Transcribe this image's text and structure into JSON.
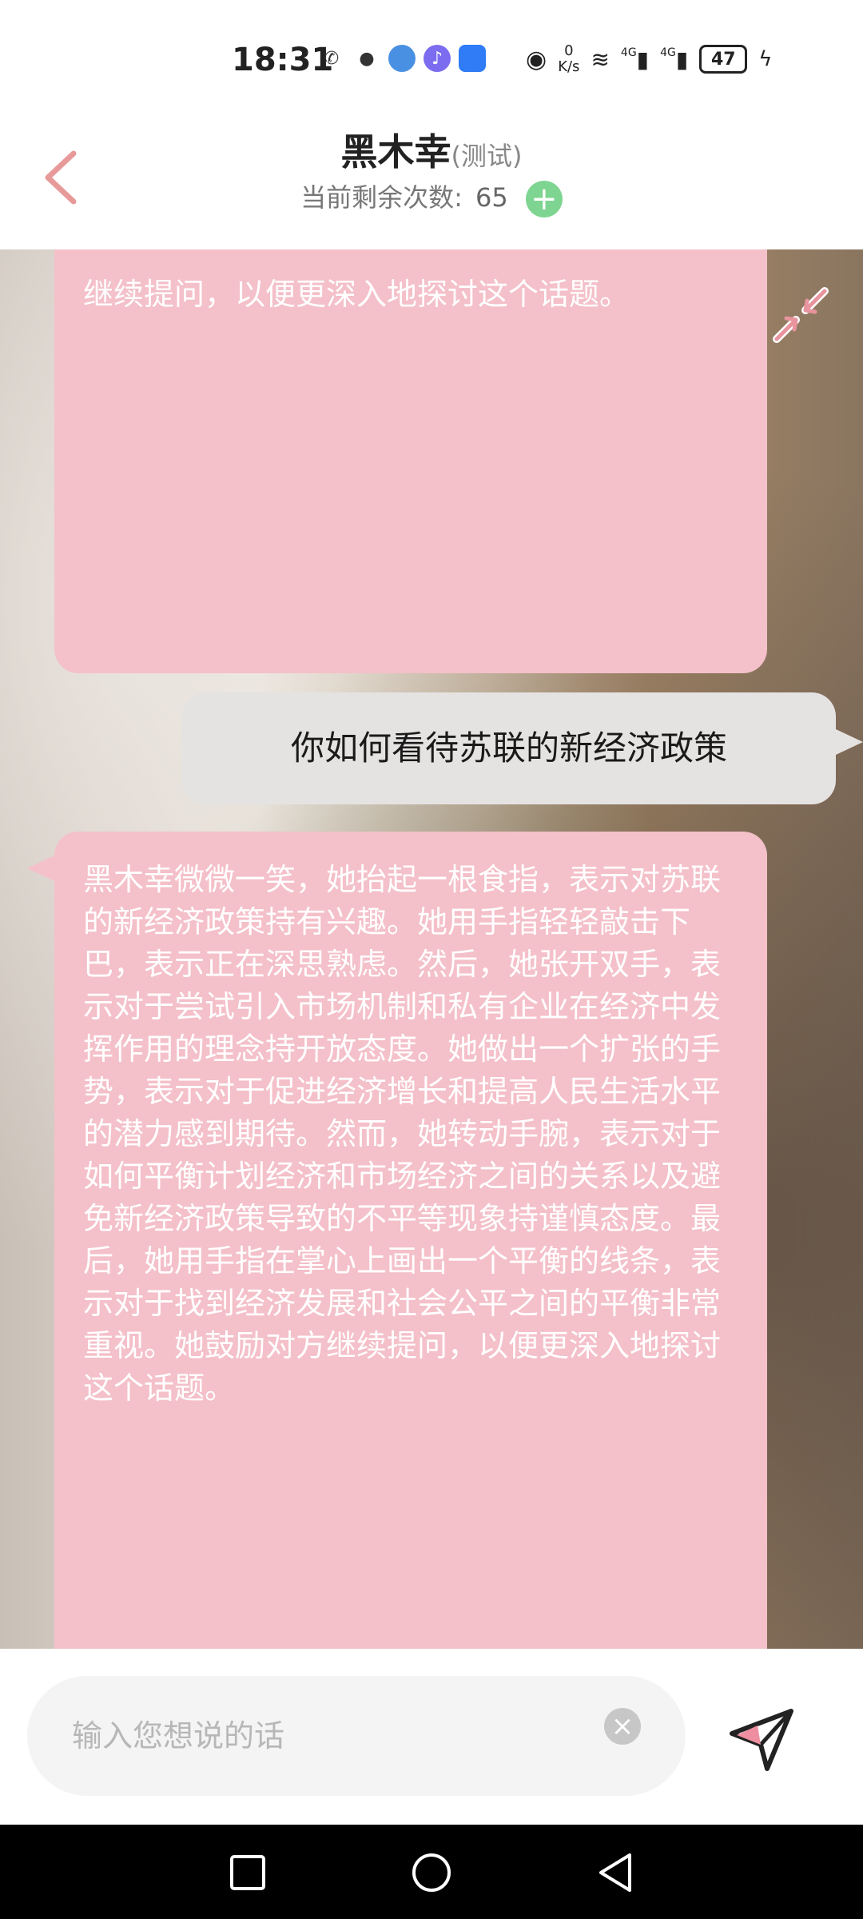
{
  "status_bar": {
    "time": "18:31",
    "net_speed_value": "0",
    "net_speed_unit": "K/s",
    "sig1_label": "4G",
    "sig2_label": "4G",
    "battery": "47"
  },
  "header": {
    "title": "黑木幸",
    "title_suffix": "(测试)",
    "remaining_label": "当前剩余次数:",
    "remaining_count": "65"
  },
  "chat": {
    "messages": [
      {
        "role": "assistant",
        "text": "继续提问，以便更深入地探讨这个话题。"
      },
      {
        "role": "user",
        "text": "你如何看待苏联的新经济政策"
      },
      {
        "role": "assistant",
        "text": "黑木幸微微一笑，她抬起一根食指，表示对苏联的新经济政策持有兴趣。她用手指轻轻敲击下巴，表示正在深思熟虑。然后，她张开双手，表示对于尝试引入市场机制和私有企业在经济中发挥作用的理念持开放态度。她做出一个扩张的手势，表示对于促进经济增长和提高人民生活水平的潜力感到期待。然而，她转动手腕，表示对于如何平衡计划经济和市场经济之间的关系以及避免新经济政策导致的不平等现象持谨慎态度。最后，她用手指在掌心上画出一个平衡的线条，表示对于找到经济发展和社会公平之间的平衡非常重视。她鼓励对方继续提问，以便更深入地探讨这个话题。"
      }
    ]
  },
  "input": {
    "placeholder": "输入您想说的话"
  },
  "colors": {
    "ai_bubble": "#f4c0c9",
    "user_bubble": "#e5e3e2",
    "accent_back": "#e89a9a",
    "plus_green": "#7ed591"
  },
  "icons": [
    "back-icon",
    "plus-icon",
    "collapse-icon",
    "clear-icon",
    "send-icon",
    "nav-recents-icon",
    "nav-home-icon",
    "nav-back-icon"
  ]
}
